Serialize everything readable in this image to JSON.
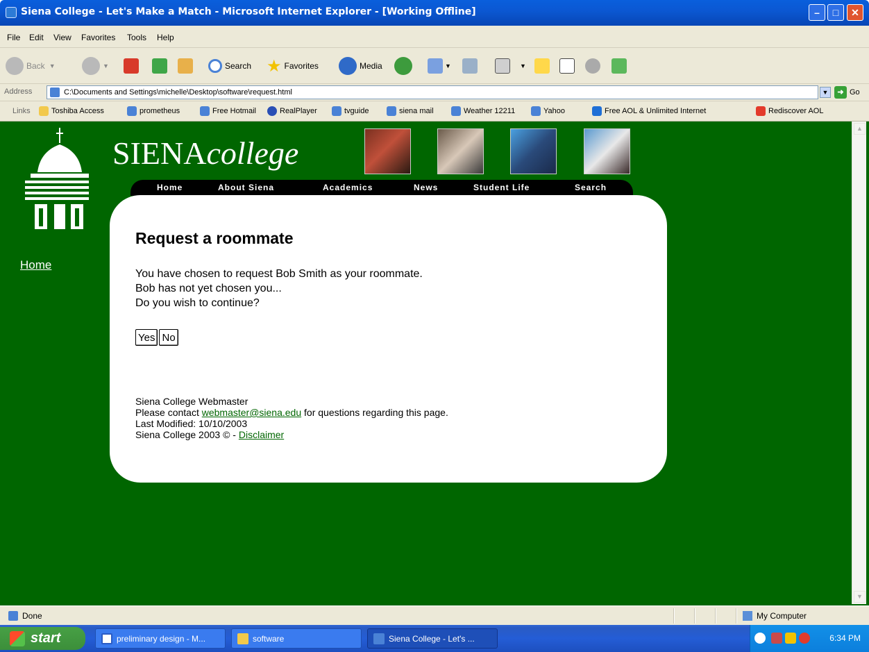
{
  "window": {
    "title": "Siena College - Let's Make a Match - Microsoft Internet Explorer - [Working Offline]"
  },
  "menu": [
    "File",
    "Edit",
    "View",
    "Favorites",
    "Tools",
    "Help"
  ],
  "toolbar": {
    "back_label": "Back",
    "search_label": "Search",
    "favorites_label": "Favorites",
    "media_label": "Media"
  },
  "address": {
    "label": "Address",
    "url": "C:\\Documents and Settings\\michelle\\Desktop\\software\\request.html",
    "go_label": "Go"
  },
  "links": {
    "label": "Links",
    "items": [
      "Toshiba Access",
      "prometheus",
      "Free Hotmail",
      "RealPlayer",
      "tvguide",
      "siena mail",
      "Weather 12211",
      "Yahoo",
      "Free AOL & Unlimited Internet",
      "Rediscover AOL"
    ]
  },
  "site": {
    "name_main": "SIENA",
    "name_italic": "college",
    "nav": [
      "Home",
      "About Siena",
      "Academics",
      "News",
      "Student Life",
      "Search"
    ],
    "side_home": "Home"
  },
  "content": {
    "heading": "Request a roommate",
    "line1": "You have chosen to request Bob Smith as your roommate.",
    "line2": "Bob has not yet chosen you...",
    "line3": "Do you wish to continue?",
    "yes_label": "Yes",
    "no_label": "No"
  },
  "footer": {
    "webmaster": "Siena College Webmaster",
    "contact_prefix": "Please contact ",
    "email": "webmaster@siena.edu",
    "contact_suffix": " for questions regarding this page.",
    "modified": "Last Modified: 10/10/2003",
    "copyright": "Siena College 2003 © - ",
    "disclaimer": "Disclaimer"
  },
  "status": {
    "left": "Done",
    "zone": "My Computer"
  },
  "taskbar": {
    "start_label": "start",
    "tasks": [
      "preliminary design - M...",
      "software",
      "Siena College - Let's ..."
    ],
    "clock": "6:34 PM"
  },
  "colors": {
    "page_bg": "#006600",
    "link_green": "#006600",
    "titlebar_blue": "#0a5fdc"
  }
}
